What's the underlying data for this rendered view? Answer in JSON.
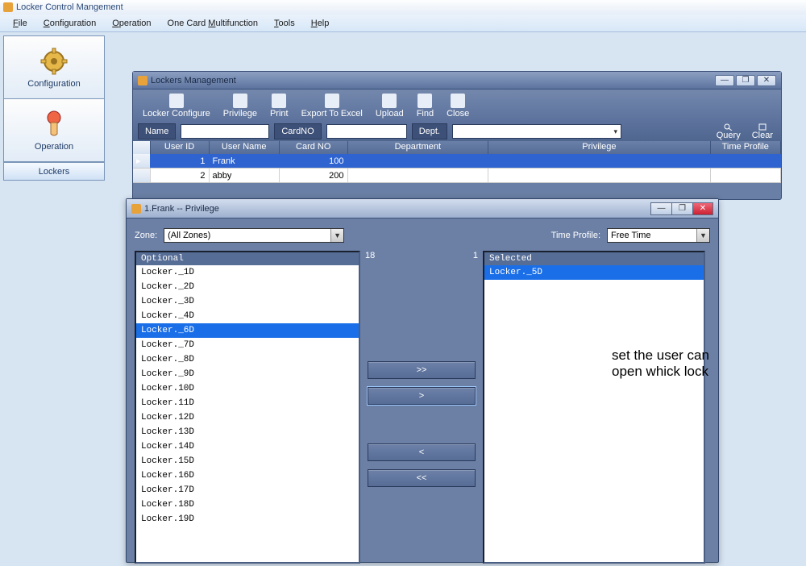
{
  "app_title": "Locker Control Mangement",
  "menu": [
    "File",
    "Configuration",
    "Operation",
    "One Card Multifunction",
    "Tools",
    "Help"
  ],
  "sidebar": {
    "configuration": "Configuration",
    "operation": "Operation",
    "lockers": "Lockers"
  },
  "child_window": {
    "title": "Lockers  Management",
    "toolbar": [
      {
        "id": "locker-configure",
        "label": "Locker Configure"
      },
      {
        "id": "privilege",
        "label": "Privilege"
      },
      {
        "id": "print",
        "label": "Print"
      },
      {
        "id": "export-excel",
        "label": "Export To Excel"
      },
      {
        "id": "upload",
        "label": "Upload"
      },
      {
        "id": "find",
        "label": "Find"
      },
      {
        "id": "close",
        "label": "Close"
      }
    ],
    "search": {
      "name_label": "Name",
      "name_value": "",
      "cardno_label": "CardNO",
      "cardno_value": "",
      "dept_label": "Dept.",
      "dept_value": "",
      "query": "Query",
      "clear": "Clear"
    },
    "columns": [
      "User ID",
      "User Name",
      "Card NO",
      "Department",
      "Privilege",
      "Time Profile"
    ],
    "rows": [
      {
        "uid": "1",
        "uname": "Frank",
        "card": "100",
        "dept": "",
        "priv": "",
        "time": "",
        "selected": true
      },
      {
        "uid": "2",
        "uname": "abby",
        "card": "200",
        "dept": "",
        "priv": "",
        "time": "",
        "selected": false
      }
    ]
  },
  "dialog": {
    "title": "1.Frank -- Privilege",
    "zone_label": "Zone:",
    "zone_value": "(All Zones)",
    "time_label": "Time Profile:",
    "time_value": "Free Time",
    "optional_hdr": "Optional",
    "selected_hdr": "Selected",
    "count_left": "18",
    "count_right": "1",
    "optional": [
      "Locker._1D",
      "Locker._2D",
      "Locker._3D",
      "Locker._4D",
      "Locker._6D",
      "Locker._7D",
      "Locker._8D",
      "Locker._9D",
      "Locker.10D",
      "Locker.11D",
      "Locker.12D",
      "Locker.13D",
      "Locker.14D",
      "Locker.15D",
      "Locker.16D",
      "Locker.17D",
      "Locker.18D",
      "Locker.19D"
    ],
    "optional_selected_index": 4,
    "selected": [
      "Locker._5D"
    ],
    "move_all_right": ">>",
    "move_right": ">",
    "move_left": "<",
    "move_all_left": "<<",
    "annotation": "set the user can open whick lock"
  }
}
